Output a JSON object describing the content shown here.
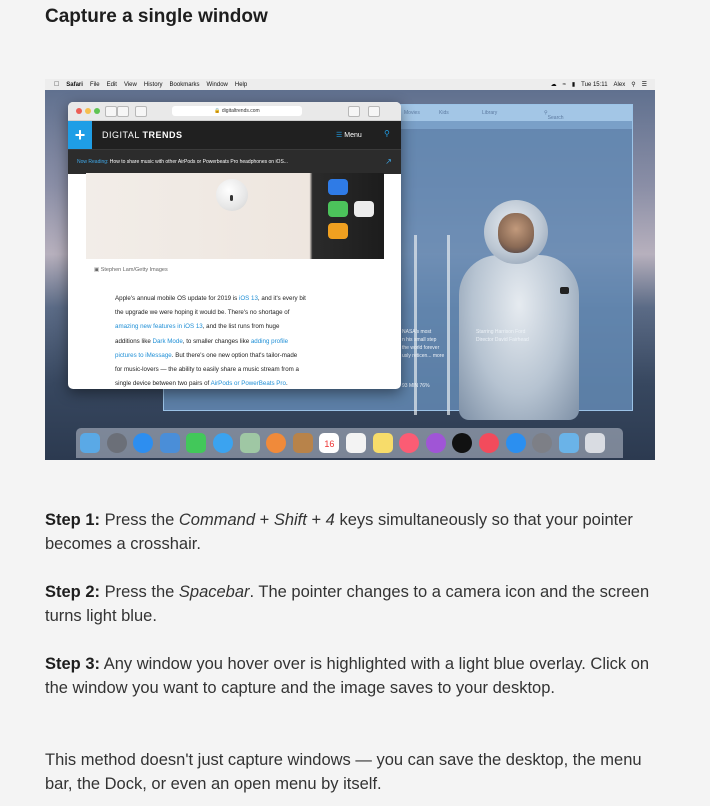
{
  "title": "Capture a single window",
  "screenshot": {
    "menubar": {
      "app": "Safari",
      "items": [
        "File",
        "Edit",
        "View",
        "History",
        "Bookmarks",
        "Window",
        "Help"
      ],
      "clock": "Tue 15:11",
      "user": "Alex"
    },
    "browser": {
      "url": "digitaltrends.com",
      "site_name_light": "DIGITAL",
      "site_name_bold": "TRENDS",
      "menu_label": "Menu",
      "now_reading_label": "Now Reading:",
      "now_reading_text": "How to share music with other AirPods or Powerbeats Pro headphones on iOS...",
      "photo_credit": "Stephen Lam/Getty Images",
      "article": {
        "l1": "Apple's annual mobile OS update for 2019 is ",
        "l1_link": "iOS 13",
        "l1b": ", and it's every bit",
        "l2": "the upgrade we were hoping it would be. There's no shortage of",
        "l3_link": "amazing new features in iOS 13",
        "l3": ", and the list runs from huge",
        "l4": "additions like ",
        "l4_link1": "Dark Mode",
        "l4b": ", to smaller changes like ",
        "l4_link2": "adding profile",
        "l5_link": "pictures to iMessage",
        "l5": ". But there's one new option that's tailor-made",
        "l6": "for music-lovers — the ability to easily share a music stream from a",
        "l7": "single device between two pairs of ",
        "l7_link": "AirPods or PowerBeats Pro",
        "l7b": "."
      }
    },
    "background_window": {
      "tabs": [
        "Movies",
        "Kids",
        "Library"
      ],
      "search": "Search",
      "desc": [
        "NASA's most",
        "n his small step",
        "the world forever",
        "usly reticen... more"
      ],
      "starring": "Starring Harrison Ford",
      "director": "Director David Fairhead",
      "meta": "93 MIN   76%"
    },
    "dock_date": "16"
  },
  "steps": [
    {
      "label": "Step 1:",
      "pre": " Press the ",
      "k1": "Command",
      "plus1": " + ",
      "k2": "Shift",
      "plus2": " + ",
      "k3": "4",
      "post": " keys simultaneously so that your pointer becomes a crosshair."
    },
    {
      "label": "Step 2:",
      "pre": " Press the ",
      "k1": "Spacebar",
      "post": ". The pointer changes to a camera icon and the screen turns light blue."
    },
    {
      "label": "Step 3:",
      "text": " Any window you hover over is highlighted with a light blue overlay. Click on the window you want to capture and the image saves to your desktop."
    }
  ],
  "closing": "This method doesn't just capture windows — you can save the desktop, the menu bar, the Dock, or even an open menu by itself.",
  "colors": {
    "link": "#1f8fd6",
    "brand": "#1f9ee6",
    "overlay": "#7eaad6"
  }
}
